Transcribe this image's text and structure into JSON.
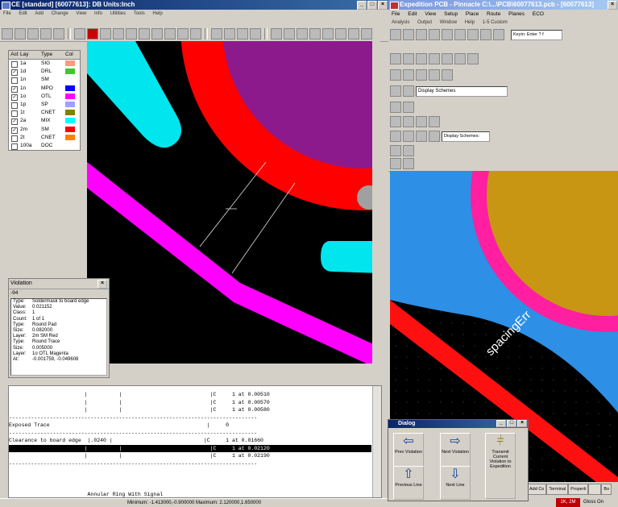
{
  "left_window": {
    "title": "CE [standard] [60077613]: DB Units:Inch",
    "menu": [
      "File",
      "Edit",
      "Add",
      "Change",
      "View",
      "Info",
      "Utilities",
      "Tools",
      "Help"
    ]
  },
  "layers": {
    "headers": [
      "Act",
      "Lay",
      "Type",
      "Col"
    ],
    "rows": [
      {
        "checked": false,
        "lay": "1a",
        "type": "SIG",
        "color": "#ff9980"
      },
      {
        "checked": true,
        "lay": "1d",
        "type": "DRL",
        "color": "#33cc33"
      },
      {
        "checked": false,
        "lay": "1n",
        "type": "SM",
        "color": "#ffffff"
      },
      {
        "checked": true,
        "lay": "1n",
        "type": "MPO",
        "color": "#0000ff"
      },
      {
        "checked": true,
        "lay": "1o",
        "type": "OTL",
        "color": "#ff00ff"
      },
      {
        "checked": false,
        "lay": "1p",
        "type": "SP",
        "color": "#a0a0ff"
      },
      {
        "checked": false,
        "lay": "1t",
        "type": "CNET",
        "color": "#808000"
      },
      {
        "checked": true,
        "lay": "2a",
        "type": "MIX",
        "color": "#00ffff"
      },
      {
        "checked": true,
        "lay": "2m",
        "type": "SM",
        "color": "#ff0000"
      },
      {
        "checked": false,
        "lay": "2t",
        "type": "CNET",
        "color": "#ff8000"
      },
      {
        "checked": false,
        "lay": "100a",
        "type": "DOC",
        "color": "#ffffff"
      }
    ]
  },
  "violation": {
    "title": "Violation",
    "id": "-94",
    "rows": [
      {
        "k": "Type:",
        "v": "Soldermask to board edge"
      },
      {
        "k": "Value:",
        "v": "0.021152"
      },
      {
        "k": "Class:",
        "v": "1"
      },
      {
        "k": "Count:",
        "v": "1 of 1"
      },
      {
        "k": "Type:",
        "v": "Round Pad"
      },
      {
        "k": "Size:",
        "v": "0.082000"
      },
      {
        "k": "Layer:",
        "v": "2m SM Red"
      },
      {
        "k": "Type:",
        "v": "Round Trace"
      },
      {
        "k": "Size:",
        "v": "0.005000"
      },
      {
        "k": "Layer:",
        "v": "1o OTL Magenta"
      },
      {
        "k": "At:",
        "v": "-0.001759, -0.049608"
      }
    ]
  },
  "report": {
    "lines": [
      {
        "text": "                        |          |                            |C     1 at 0.00510",
        "selected": false
      },
      {
        "text": "                        |          |                            |C     1 at 0.00570",
        "selected": false
      },
      {
        "text": "                        |          |                            |C     1 at 0.00580",
        "selected": false
      },
      {
        "text": "-------------------------------------------------------------------------------",
        "selected": false
      },
      {
        "text": "Exposed Trace                                                  |     0",
        "selected": false
      },
      {
        "text": "-------------------------------------------------------------------------------",
        "selected": false
      },
      {
        "text": "Clearance to board edge  |.0240 |                             |C     1 at 0.01660",
        "selected": false
      },
      {
        "text": "                        |          |                            |C     1 at 0.02120",
        "selected": true
      },
      {
        "text": "                        |          |                            |C     1 at 0.02190",
        "selected": false
      },
      {
        "text": "-------------------------------------------------------------------------------",
        "selected": false
      },
      {
        "text": "",
        "selected": false
      },
      {
        "text": "",
        "selected": false
      },
      {
        "text": "",
        "selected": false
      },
      {
        "text": "                         Annular Ring With Signal",
        "selected": false
      }
    ]
  },
  "status": {
    "text": "Minimum: -1.413000,-0.900000 Maximum: 2.120000,1.650000"
  },
  "right_window": {
    "title": "Expedition PCB - Pinnacle C:\\...\\PCB\\60077613.pcb - [60077613]",
    "menu": [
      "File",
      "Edit",
      "View",
      "Setup",
      "Place",
      "Route",
      "Planes",
      "ECO"
    ],
    "menu2": [
      "Analysis",
      "Output",
      "Window",
      "Help",
      "1-5 Custom"
    ],
    "keyin": "Keyin: Enter ? f",
    "scheme1": "Display Schemes",
    "scheme2": "Display Schemes:",
    "annotation": "spacingErr",
    "tabs": [
      "Add Co",
      "Terminal",
      "Properti",
      "",
      "Bo"
    ],
    "status_a": "1K, 2M",
    "status_b": "Gloss On"
  },
  "dialog": {
    "title": "Dialog",
    "btn_prev_violation": "Prev Violation",
    "btn_next_violation": "Next Violation",
    "btn_transmit": "Transmit Current Violation to Expedition",
    "btn_prev_line": "Previous Line",
    "btn_next_line": "Next Line"
  }
}
